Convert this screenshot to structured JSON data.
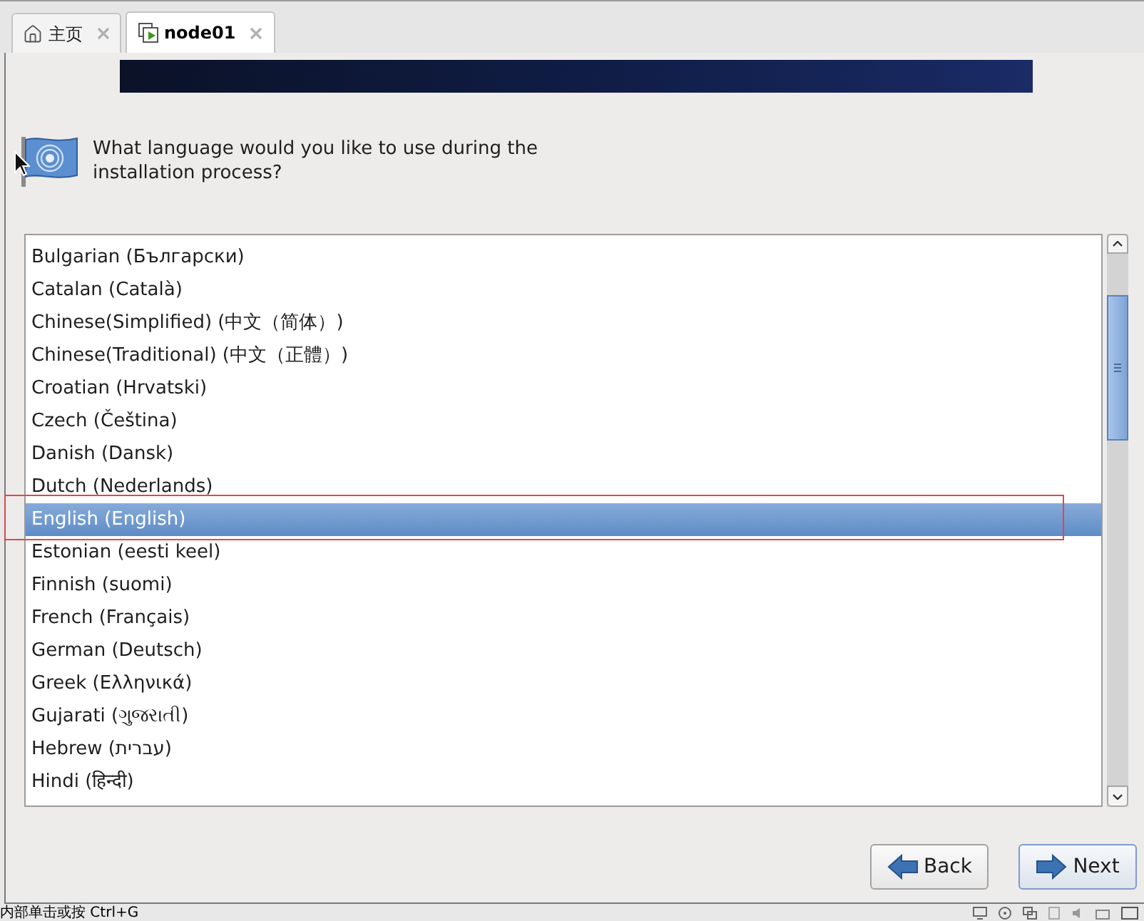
{
  "tabs": [
    {
      "label": "主页",
      "kind": "home",
      "selected": false
    },
    {
      "label": "node01",
      "kind": "vm",
      "selected": true
    }
  ],
  "prompt": "What language would you like to use during the installation process?",
  "languages": [
    {
      "label": "Bulgarian (Български)",
      "selected": false
    },
    {
      "label": "Catalan (Català)",
      "selected": false
    },
    {
      "label": "Chinese(Simplified) (中文（简体）)",
      "selected": false
    },
    {
      "label": "Chinese(Traditional) (中文（正體）)",
      "selected": false
    },
    {
      "label": "Croatian (Hrvatski)",
      "selected": false
    },
    {
      "label": "Czech (Čeština)",
      "selected": false
    },
    {
      "label": "Danish (Dansk)",
      "selected": false
    },
    {
      "label": "Dutch (Nederlands)",
      "selected": false
    },
    {
      "label": "English (English)",
      "selected": true
    },
    {
      "label": "Estonian (eesti keel)",
      "selected": false
    },
    {
      "label": "Finnish (suomi)",
      "selected": false
    },
    {
      "label": "French (Français)",
      "selected": false
    },
    {
      "label": "German (Deutsch)",
      "selected": false
    },
    {
      "label": "Greek (Ελληνικά)",
      "selected": false
    },
    {
      "label": "Gujarati (ગુજરાતી)",
      "selected": false
    },
    {
      "label": "Hebrew (עברית)",
      "selected": false
    },
    {
      "label": "Hindi (हिन्दी)",
      "selected": false
    }
  ],
  "buttons": [
    {
      "label": "Back",
      "kind": "back",
      "focused": false
    },
    {
      "label": "Next",
      "kind": "next",
      "focused": true
    }
  ],
  "status_bar": {
    "text": "内部单击或按 Ctrl+G"
  }
}
